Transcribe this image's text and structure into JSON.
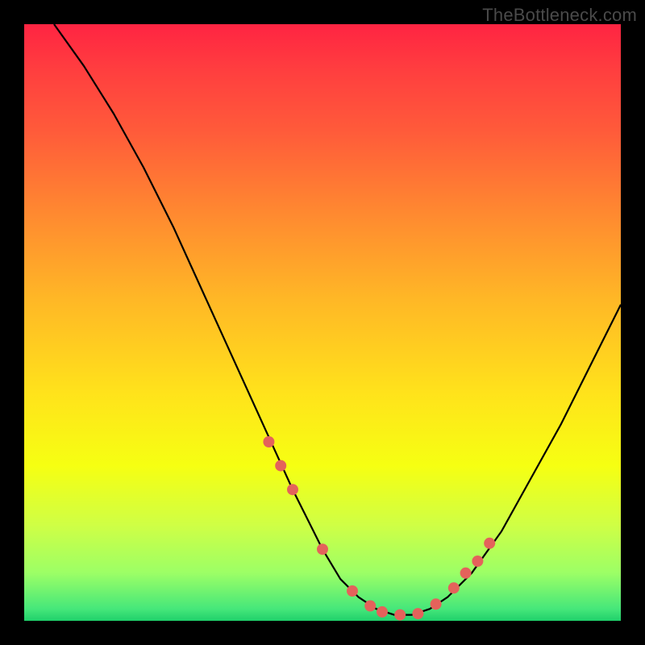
{
  "watermark": "TheBottleneck.com",
  "chart_data": {
    "type": "line",
    "title": "",
    "xlabel": "",
    "ylabel": "",
    "xlim": [
      0,
      100
    ],
    "ylim": [
      0,
      100
    ],
    "series": [
      {
        "name": "curve",
        "x": [
          5,
          10,
          15,
          20,
          25,
          30,
          35,
          40,
          45,
          50,
          53,
          56,
          59,
          62,
          65,
          68,
          71,
          75,
          80,
          85,
          90,
          95,
          100
        ],
        "y": [
          100,
          93,
          85,
          76,
          66,
          55,
          44,
          33,
          22,
          12,
          7,
          4,
          2,
          1,
          1,
          2,
          4,
          8,
          15,
          24,
          33,
          43,
          53
        ]
      }
    ],
    "markers": {
      "name": "highlight-points",
      "x": [
        41,
        43,
        45,
        50,
        55,
        58,
        60,
        63,
        66,
        69,
        72,
        74,
        76,
        78
      ],
      "y": [
        30,
        26,
        22,
        12,
        5,
        2.5,
        1.5,
        1,
        1.2,
        2.8,
        5.5,
        8,
        10,
        13
      ]
    }
  }
}
